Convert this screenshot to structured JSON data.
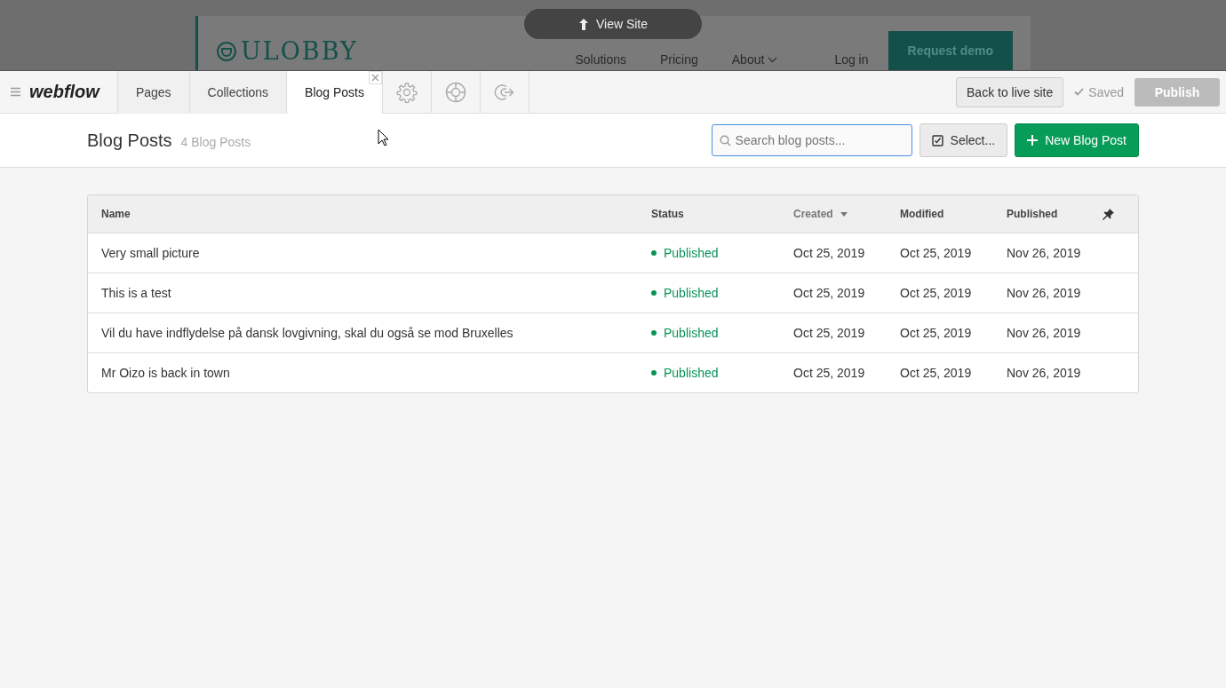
{
  "site_preview": {
    "logo": "ULOBBY",
    "nav": [
      "Solutions",
      "Pricing",
      "About"
    ],
    "login": "Log in",
    "cta": "Request demo",
    "view_site": "View Site"
  },
  "toolbar": {
    "brand": "webflow",
    "tabs": [
      {
        "label": "Pages",
        "selected": false
      },
      {
        "label": "Collections",
        "selected": false
      },
      {
        "label": "Blog Posts",
        "selected": true,
        "closable": true
      }
    ],
    "icon_tabs": [
      {
        "kind": "gear"
      },
      {
        "kind": "lifebuoy"
      },
      {
        "kind": "exit"
      }
    ],
    "back": "Back to live site",
    "saved": "Saved",
    "publish": {
      "label": "Publish",
      "disabled": true
    }
  },
  "header": {
    "title": "Blog Posts",
    "count": "4 Blog Posts",
    "search": {
      "placeholder": "Search blog posts..."
    },
    "select": "Select...",
    "new": "New Blog Post"
  },
  "table": {
    "columns": [
      {
        "label": "Name",
        "sorted": false
      },
      {
        "label": "Status",
        "sorted": false
      },
      {
        "label": "Created",
        "sorted": true
      },
      {
        "label": "Modified",
        "sorted": false
      },
      {
        "label": "Published",
        "sorted": false
      }
    ],
    "rows": [
      {
        "name": "Very small picture",
        "status": "Published",
        "color": "#079455",
        "created": "Oct 25, 2019",
        "modified": "Oct 25, 2019",
        "published": "Nov 26, 2019"
      },
      {
        "name": "This is a test",
        "status": "Published",
        "color": "#079455",
        "created": "Oct 25, 2019",
        "modified": "Oct 25, 2019",
        "published": "Nov 26, 2019"
      },
      {
        "name": "Vil du have indflydelse på dansk lovgivning, skal du også se mod Bruxelles",
        "status": "Published",
        "color": "#079455",
        "created": "Oct 25, 2019",
        "modified": "Oct 25, 2019",
        "published": "Nov 26, 2019"
      },
      {
        "name": "Mr Oizo is back in town",
        "status": "Published",
        "color": "#079455",
        "created": "Oct 25, 2019",
        "modified": "Oct 25, 2019",
        "published": "Nov 26, 2019"
      }
    ]
  }
}
